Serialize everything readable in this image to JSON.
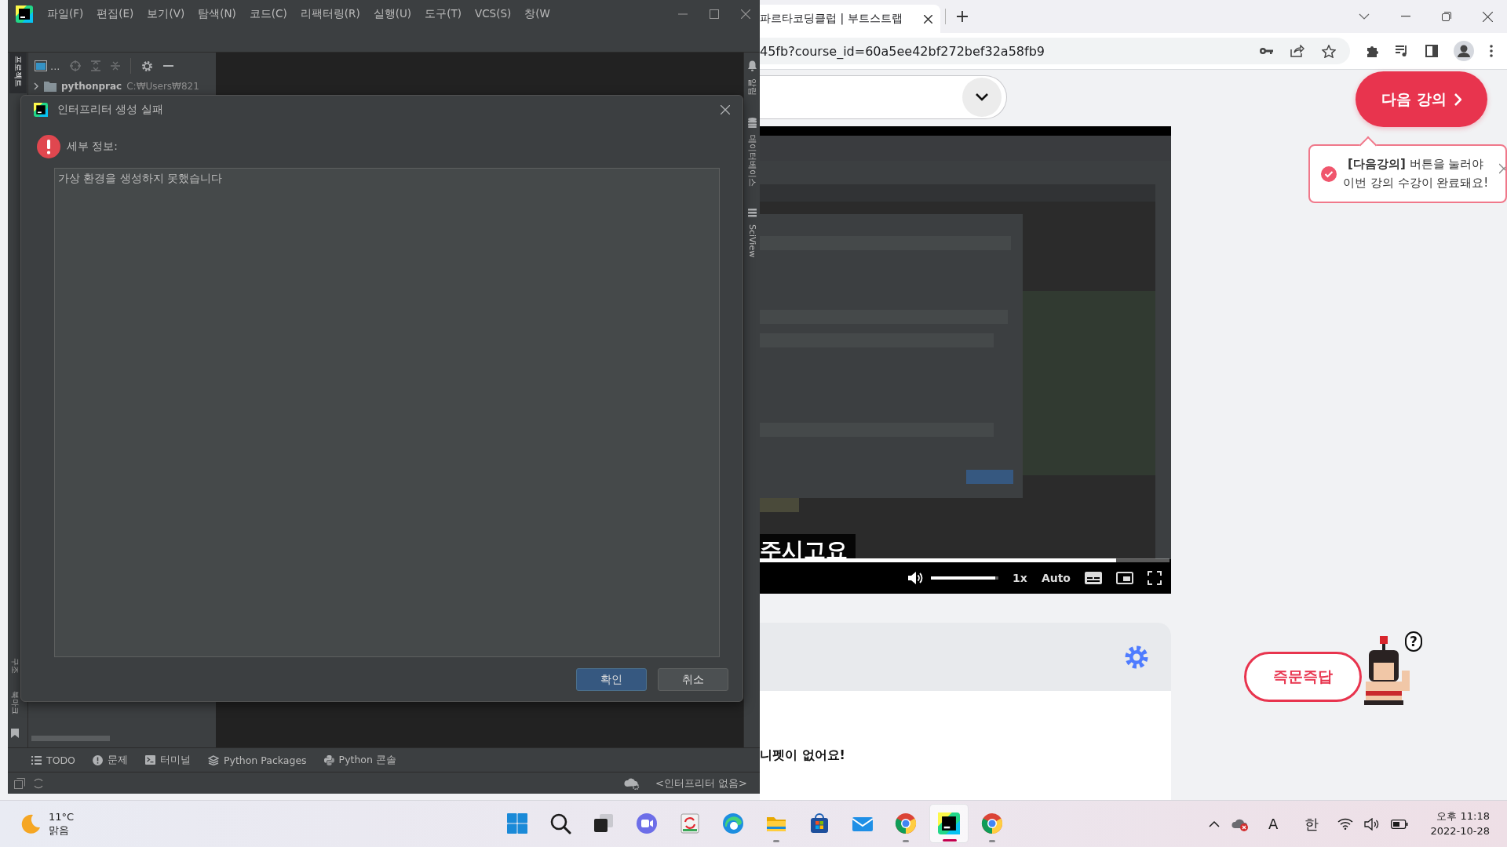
{
  "ide": {
    "menu": [
      {
        "label": "파일(F)"
      },
      {
        "label": "편집(E)"
      },
      {
        "label": "보기(V)"
      },
      {
        "label": "탐색(N)"
      },
      {
        "label": "코드(C)"
      },
      {
        "label": "리팩터링(R)"
      },
      {
        "label": "실행(U)"
      },
      {
        "label": "도구(T)"
      },
      {
        "label": "VCS(S)"
      },
      {
        "label": "창(W"
      }
    ],
    "left_strip": {
      "top": {
        "label": "프로젝트",
        "selected": true
      },
      "bottom": [
        {
          "label": "구조"
        },
        {
          "label": "북마크"
        }
      ]
    },
    "right_strip": [
      {
        "label": "알림",
        "kind": "bell"
      },
      {
        "label": "데이터베이스",
        "kind": "database"
      },
      {
        "label": "SciView",
        "kind": "grid"
      }
    ],
    "project_panel": {
      "view_label": "...",
      "root": {
        "name": "pythonprac",
        "path": "C:₩Users₩821",
        "expanded": false
      }
    },
    "dialog": {
      "title": "인터프리터 생성 실패",
      "detail_label": "세부 정보:",
      "message": "가상 환경을 생성하지 못했습니다",
      "buttons": [
        {
          "label": "확인",
          "kind": "primary"
        },
        {
          "label": "취소",
          "kind": "secondary"
        }
      ]
    },
    "tool_tabs": [
      {
        "label": "TODO",
        "kind": "list"
      },
      {
        "label": "문제",
        "kind": "problems"
      },
      {
        "label": "터미널",
        "kind": "terminal"
      },
      {
        "label": "Python Packages",
        "kind": "packages"
      },
      {
        "label": "Python 콘솔",
        "kind": "python"
      }
    ],
    "status": {
      "interpreter": "<인터프리터 없음>"
    }
  },
  "browser": {
    "tab": {
      "title": "파르타코딩클럽 | 부트스트랩"
    },
    "address": "45fb?course_id=60a5ee42bf272bef32a58fb9",
    "next_button": "다음 강의",
    "tooltip": {
      "lines": [
        "**[다음강의]** 버튼을 눌러야",
        "이번 강의 수강이 완료돼요!"
      ]
    },
    "video": {
      "kind": "picture",
      "caption": "주시고요",
      "progress": {
        "level": 0.87
      },
      "volume": {
        "level": 0.95
      },
      "speed": "1x",
      "quality": "Auto"
    },
    "snippets": {
      "empty": "니펫이 없어요!"
    },
    "qa_button": "즉문즉답",
    "qa_mark": "?"
  },
  "taskbar": {
    "weather": {
      "temp": "11°C",
      "condition": "맑음"
    },
    "apps": [
      {
        "kind": "start",
        "running": false,
        "selected": false
      },
      {
        "kind": "search",
        "running": false,
        "selected": false
      },
      {
        "kind": "taskview",
        "running": false,
        "selected": false
      },
      {
        "kind": "chat",
        "running": false,
        "selected": false
      },
      {
        "kind": "sync",
        "running": false,
        "selected": false
      },
      {
        "kind": "edge",
        "running": false,
        "selected": false
      },
      {
        "kind": "explorer",
        "running": true,
        "selected": false
      },
      {
        "kind": "store",
        "running": false,
        "selected": false
      },
      {
        "kind": "mail",
        "running": false,
        "selected": false
      },
      {
        "kind": "chrome",
        "running": true,
        "selected": false
      },
      {
        "kind": "pycharm",
        "running": true,
        "selected": true
      },
      {
        "kind": "chrome",
        "running": true,
        "selected": false
      }
    ],
    "tray": {
      "ime_mode": "A",
      "ime_lang": "한",
      "time": "오후 11:18",
      "date": "2022-10-28"
    }
  }
}
